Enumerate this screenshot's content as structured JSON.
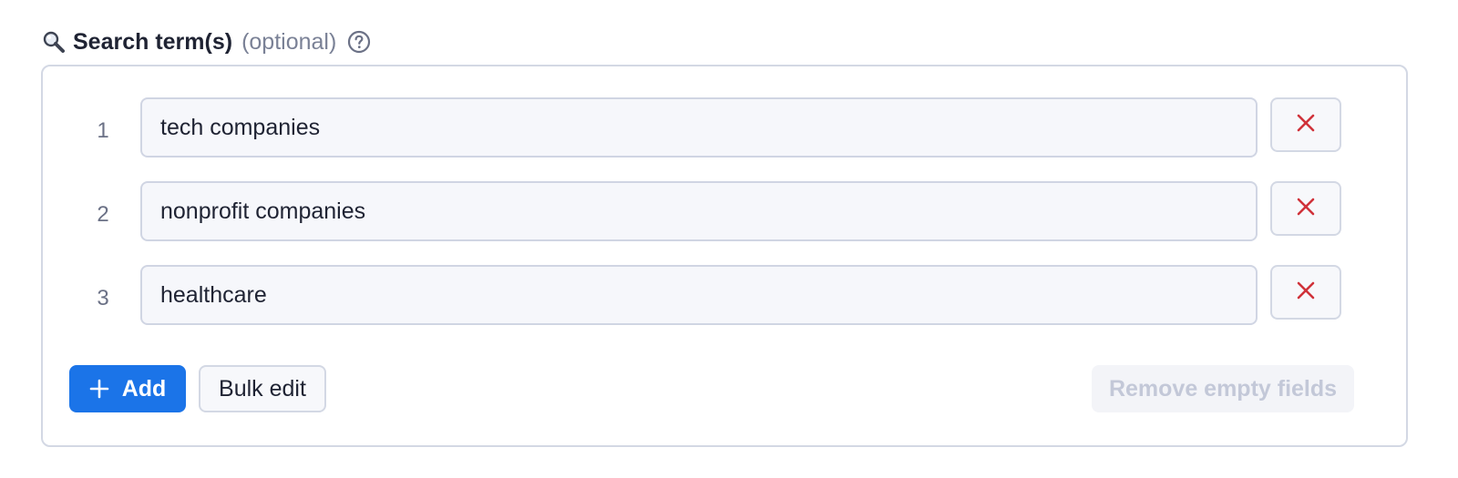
{
  "field": {
    "label": "Search term(s)",
    "optional_text": "(optional)",
    "label_icon": "magnifier-icon",
    "help_icon": "question-circle-icon"
  },
  "terms": [
    {
      "number": "1",
      "value": "tech companies"
    },
    {
      "number": "2",
      "value": "nonprofit companies"
    },
    {
      "number": "3",
      "value": "healthcare"
    }
  ],
  "actions": {
    "add_label": "Add",
    "bulk_edit_label": "Bulk edit",
    "remove_empty_label": "Remove empty fields",
    "remove_empty_disabled": true
  },
  "colors": {
    "primary": "#1b74e8",
    "remove_icon": "#d0323a",
    "border": "#d3d8e4",
    "input_bg": "#f6f7fb",
    "muted_text": "#7a8196",
    "disabled_text": "#c3c8d8"
  },
  "icons": {
    "remove": "close-icon",
    "add": "plus-icon"
  }
}
